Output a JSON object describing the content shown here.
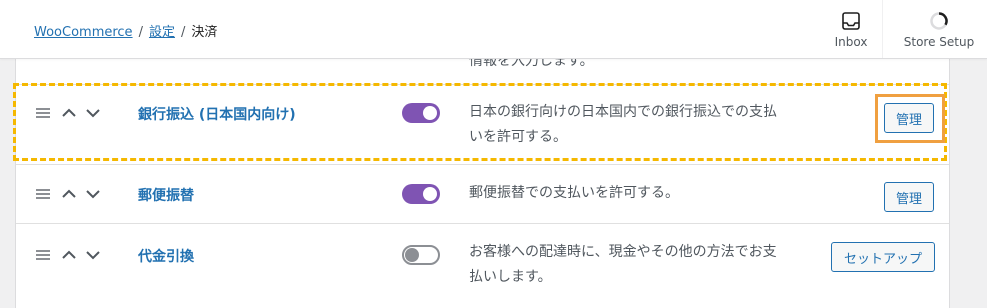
{
  "breadcrumb": {
    "woocommerce": "WooCommerce",
    "settings": "設定",
    "current": "決済",
    "separator": "/"
  },
  "header_actions": {
    "inbox": "Inbox",
    "store_setup": "Store Setup"
  },
  "partial_row_text": "情報を入力します。",
  "payment_methods": [
    {
      "name": "銀行振込 (日本国内向け)",
      "enabled": true,
      "description_line1": "日本の銀行向けの日本国内での銀行振込での支払",
      "description_line2": "いを許可する。",
      "action": "管理"
    },
    {
      "name": "郵便振替",
      "enabled": true,
      "description_line1": "郵便振替での支払いを許可する。",
      "description_line2": "",
      "action": "管理"
    },
    {
      "name": "代金引換",
      "enabled": false,
      "description_line1": "お客様への配達時に、現金やその他の方法でお支",
      "description_line2": "払いします。",
      "action": "セットアップ"
    }
  ],
  "colors": {
    "toggle_on": "#7f54b3",
    "link": "#2271b1",
    "highlight_dashed": "#f5b800",
    "highlight_solid": "#f0a040"
  }
}
